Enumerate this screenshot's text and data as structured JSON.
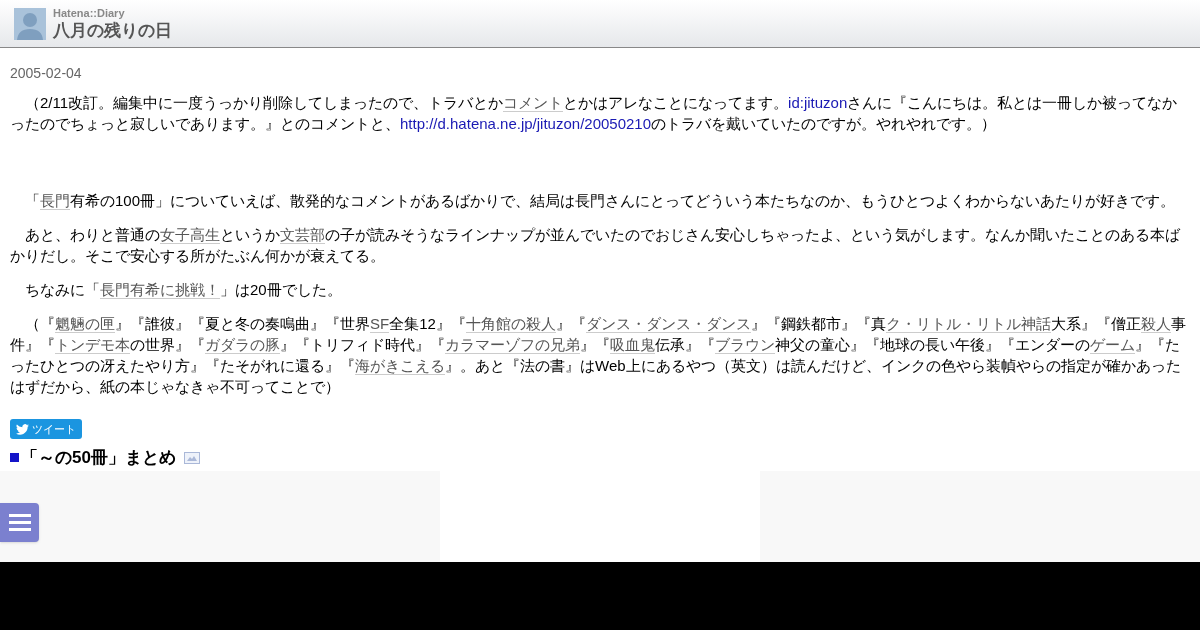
{
  "header": {
    "site": "Hatena::Diary",
    "title": "八月の残りの日"
  },
  "date": "2005-02-04",
  "paragraphs": [
    [
      {
        "kind": "plain",
        "text": "（2/11改訂。編集中に一度うっかり削除してしまったので、トラバとか"
      },
      {
        "kind": "keyword",
        "text": "コメント"
      },
      {
        "kind": "plain",
        "text": "とかはアレなことになってます。"
      },
      {
        "kind": "link",
        "text": "id:jituzon"
      },
      {
        "kind": "plain",
        "text": "さんに『こんにちは。私とは一冊しか被ってなかったのでちょっと寂しいであります。』とのコメントと、"
      },
      {
        "kind": "link",
        "text": "http://d.hatena.ne.jp/jituzon/20050210"
      },
      {
        "kind": "plain",
        "text": "のトラバを戴いていたのですが。やれやれです。）"
      }
    ],
    [
      {
        "kind": "gap"
      }
    ],
    [
      {
        "kind": "plain",
        "text": "「"
      },
      {
        "kind": "keyword",
        "text": "長門"
      },
      {
        "kind": "plain",
        "text": "有希の100冊」についていえば、散発的なコメントがあるばかりで、結局は長門さんにとってどういう本たちなのか、もうひとつよくわからないあたりが好きです。"
      }
    ],
    [
      {
        "kind": "plain",
        "text": "あと、わりと普通の"
      },
      {
        "kind": "keyword",
        "text": "女子高生"
      },
      {
        "kind": "plain",
        "text": "というか"
      },
      {
        "kind": "keyword",
        "text": "文芸部"
      },
      {
        "kind": "plain",
        "text": "の子が読みそうなラインナップが並んでいたのでおじさん安心しちゃったよ、という気がします。なんか聞いたことのある本ばかりだし。そこで安心する所がたぶん何かが衰えてる。"
      }
    ],
    [
      {
        "kind": "plain",
        "text": "ちなみに「"
      },
      {
        "kind": "keyword",
        "text": "長門有希に挑戦！"
      },
      {
        "kind": "plain",
        "text": "」は20冊でした。"
      }
    ],
    [
      {
        "kind": "plain",
        "text": "（『"
      },
      {
        "kind": "keyword",
        "text": "魍魎の匣"
      },
      {
        "kind": "plain",
        "text": "』『誰彼』『夏と冬の奏鳴曲』『世界"
      },
      {
        "kind": "keyword",
        "text": "SF"
      },
      {
        "kind": "plain",
        "text": "全集12』『"
      },
      {
        "kind": "keyword",
        "text": "十角館の殺人"
      },
      {
        "kind": "plain",
        "text": "』『"
      },
      {
        "kind": "keyword",
        "text": "ダンス・ダンス・ダンス"
      },
      {
        "kind": "plain",
        "text": "』『鋼鉄都市』『真"
      },
      {
        "kind": "keyword",
        "text": "ク・リトル・リトル神話"
      },
      {
        "kind": "plain",
        "text": "大系』『僧正"
      },
      {
        "kind": "keyword",
        "text": "殺人"
      },
      {
        "kind": "plain",
        "text": "事件』『"
      },
      {
        "kind": "keyword",
        "text": "トンデモ本"
      },
      {
        "kind": "plain",
        "text": "の世界』『"
      },
      {
        "kind": "keyword",
        "text": "ガダラの豚"
      },
      {
        "kind": "plain",
        "text": "』『トリフィド時代』『"
      },
      {
        "kind": "keyword",
        "text": "カラマーゾフの兄弟"
      },
      {
        "kind": "plain",
        "text": "』『"
      },
      {
        "kind": "keyword",
        "text": "吸血鬼"
      },
      {
        "kind": "plain",
        "text": "伝承』『"
      },
      {
        "kind": "keyword",
        "text": "ブラウン"
      },
      {
        "kind": "plain",
        "text": "神父の童心』『地球の長い午後』『エンダーの"
      },
      {
        "kind": "keyword",
        "text": "ゲーム"
      },
      {
        "kind": "plain",
        "text": "』『たったひとつの冴えたやり方』『たそがれに還る』『"
      },
      {
        "kind": "keyword",
        "text": "海がきこえる"
      },
      {
        "kind": "plain",
        "text": "』。あと『法の書』はWeb上にあるやつ（英文）は読んだけど、インクの色やら装幀やらの指定が確かあったはずだから、紙の本じゃなきゃ不可ってことで）"
      }
    ]
  ],
  "tweet_button": "ツイート",
  "next_section": {
    "title": "「～の50冊」まとめ"
  }
}
